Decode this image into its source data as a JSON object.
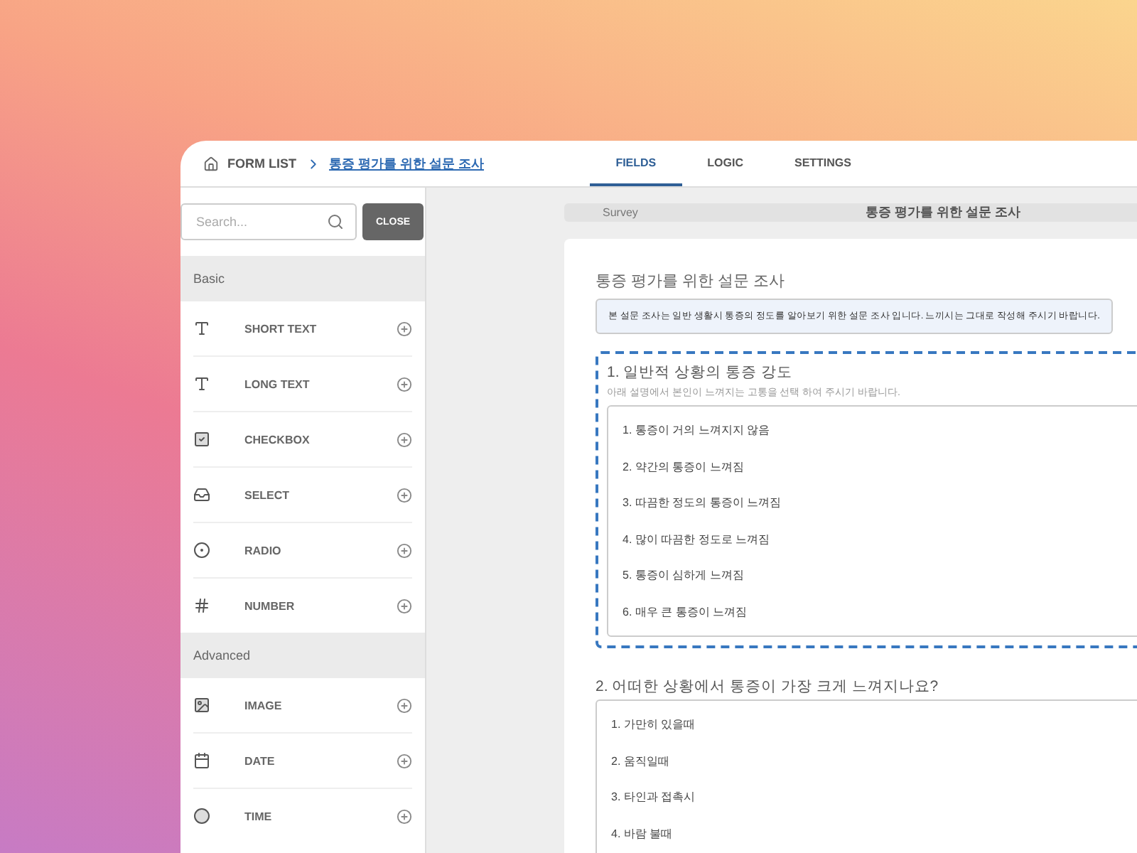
{
  "header": {
    "breadcrumb": {
      "root": "FORM LIST",
      "current": "통증 평가를 위한 설문 조사"
    },
    "tabs": [
      {
        "label": "FIELDS",
        "selected": true
      },
      {
        "label": "LOGIC",
        "selected": false
      },
      {
        "label": "SETTINGS",
        "selected": false
      }
    ]
  },
  "sidebar": {
    "search": {
      "placeholder": "Search..."
    },
    "close_button": "CLOSE",
    "sections": [
      {
        "title": "Basic",
        "items": [
          {
            "label": "SHORT TEXT",
            "kind": "short-text"
          },
          {
            "label": "LONG TEXT",
            "kind": "long-text"
          },
          {
            "label": "CHECKBOX",
            "kind": "checkbox"
          },
          {
            "label": "SELECT",
            "kind": "select"
          },
          {
            "label": "RADIO",
            "kind": "radio"
          },
          {
            "label": "NUMBER",
            "kind": "number"
          }
        ]
      },
      {
        "title": "Advanced",
        "items": [
          {
            "label": "IMAGE",
            "kind": "image"
          },
          {
            "label": "DATE",
            "kind": "date"
          },
          {
            "label": "TIME",
            "kind": "time"
          }
        ]
      }
    ]
  },
  "survey_bar": {
    "label": "Survey",
    "title": "통증 평가를 위한 설문 조사"
  },
  "form": {
    "title": "통증 평가를 위한 설문 조사",
    "description": "본 설문 조사는 일반 생활시 통증의 정도를 알아보기 위한 설문 조사 입니다.  느끼시는 그대로 작성해 주시기 바랍니다.",
    "questions": [
      {
        "title": "1. 일반적 상황의 통증 강도",
        "hint": "아래 설명에서 본인이 느껴지는 고통을 선택 하여 주시기 바랍니다.",
        "selected": true,
        "options": [
          "1. 통증이 거의 느껴지지 않음",
          "2. 약간의 통증이 느껴짐",
          "3. 따끔한 정도의 통증이 느껴짐",
          "4. 많이 따끔한 정도로 느껴짐",
          "5. 통증이 심하게 느껴짐",
          "6. 매우 큰 통증이 느껴짐"
        ]
      },
      {
        "title": "2. 어떠한 상황에서 통증이 가장 크게 느껴지나요?",
        "selected": false,
        "options": [
          "1. 가만히 있을때",
          "2. 움직일때",
          "3. 타인과 접촉시",
          "4. 바람 불때"
        ]
      }
    ]
  }
}
